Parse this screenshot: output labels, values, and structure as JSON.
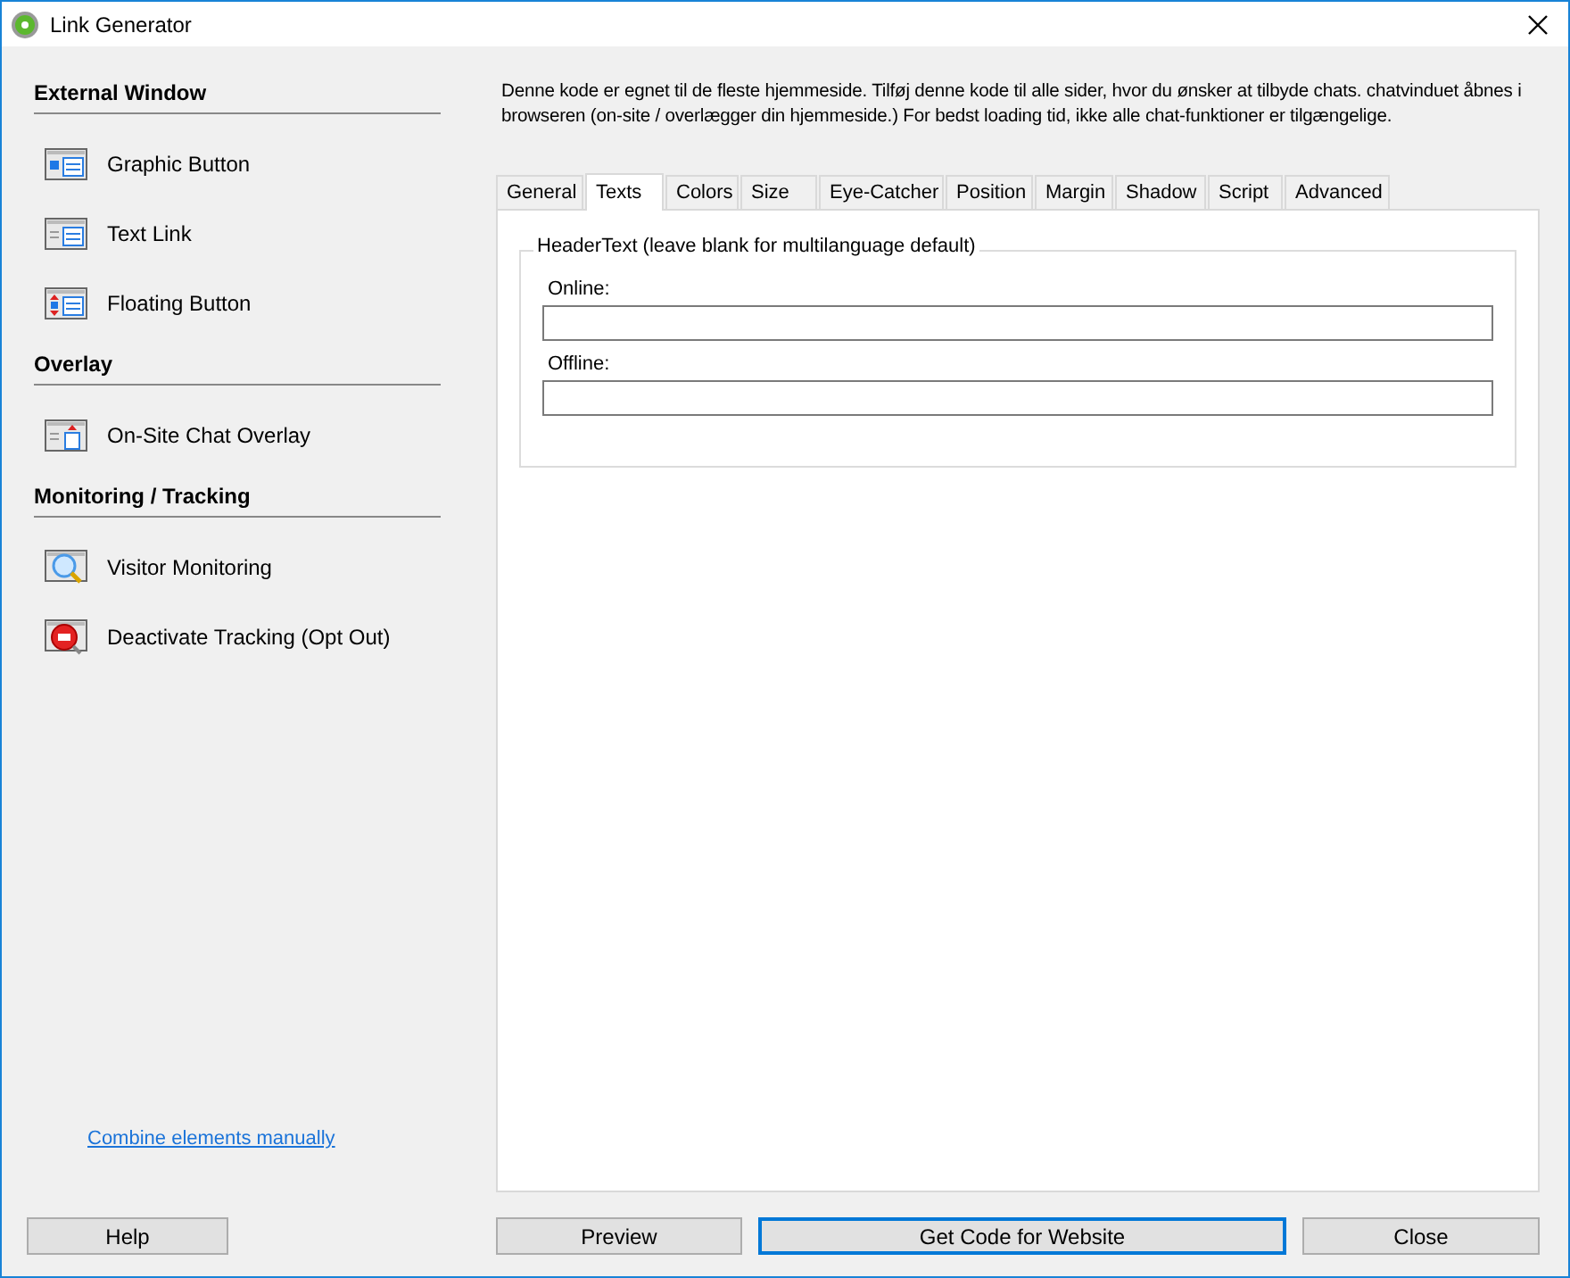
{
  "window": {
    "title": "Link Generator"
  },
  "sidebar": {
    "sections": [
      {
        "title": "External Window",
        "items": [
          {
            "label": "Graphic Button",
            "kind": "graphic"
          },
          {
            "label": "Text Link",
            "kind": "text"
          },
          {
            "label": "Floating Button",
            "kind": "floating"
          }
        ]
      },
      {
        "title": "Overlay",
        "items": [
          {
            "label": "On-Site Chat Overlay",
            "kind": "overlay"
          }
        ]
      },
      {
        "title": "Monitoring / Tracking",
        "items": [
          {
            "label": "Visitor Monitoring",
            "kind": "monitor"
          },
          {
            "label": "Deactivate Tracking (Opt Out)",
            "kind": "stop"
          }
        ]
      }
    ],
    "link": "Combine elements manually"
  },
  "description": "Denne kode er egnet til de fleste hjemmeside. Tilføj denne kode til alle sider, hvor du ønsker at tilbyde chats. chatvinduet åbnes i browseren (on-site / overlægger din hjemmeside.) For bedst loading tid, ikke alle chat-funktioner er tilgængelige.",
  "tabs": [
    {
      "label": "General",
      "selected": false
    },
    {
      "label": "Texts",
      "selected": true
    },
    {
      "label": "Colors",
      "selected": false
    },
    {
      "label": "Size",
      "selected": false
    },
    {
      "label": "Eye-Catcher",
      "selected": false
    },
    {
      "label": "Position",
      "selected": false
    },
    {
      "label": "Margin",
      "selected": false
    },
    {
      "label": "Shadow",
      "selected": false
    },
    {
      "label": "Script",
      "selected": false
    },
    {
      "label": "Advanced",
      "selected": false
    }
  ],
  "group": {
    "title": "HeaderText (leave blank for multilanguage default)",
    "fields": [
      {
        "label": "Online:"
      },
      {
        "label": "Offline:"
      }
    ]
  },
  "buttons": [
    {
      "label": "Help",
      "focused": false
    },
    {
      "label": "Preview",
      "focused": false
    },
    {
      "label": "Get Code for Website",
      "focused": true
    },
    {
      "label": "Close",
      "focused": false
    }
  ]
}
